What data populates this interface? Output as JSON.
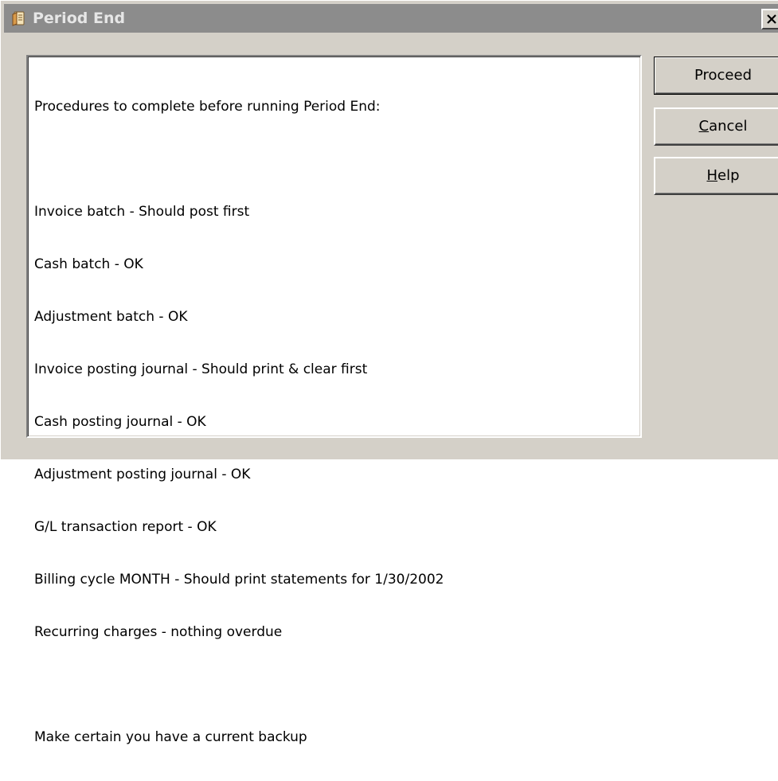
{
  "window": {
    "title": "Period End",
    "icon": "period-end-icon",
    "close_label": "X"
  },
  "text_area": {
    "heading": "Procedures to complete before running Period End:",
    "items": [
      "Invoice batch - Should post first",
      "Cash batch - OK",
      "Adjustment batch - OK",
      "Invoice posting journal - Should print & clear first",
      "Cash posting journal - OK",
      "Adjustment posting journal - OK",
      "G/L transaction report - OK",
      "Billing cycle MONTH - Should print statements for 1/30/2002",
      "Recurring charges - nothing overdue"
    ],
    "footer": "Make certain you have a current backup"
  },
  "buttons": {
    "proceed": "Proceed",
    "cancel": "Cancel",
    "help": "Help"
  },
  "colors": {
    "titlebar": "#8c8c8c",
    "title_text": "#e6e6e6",
    "dialog_face": "#d4d0c8"
  }
}
